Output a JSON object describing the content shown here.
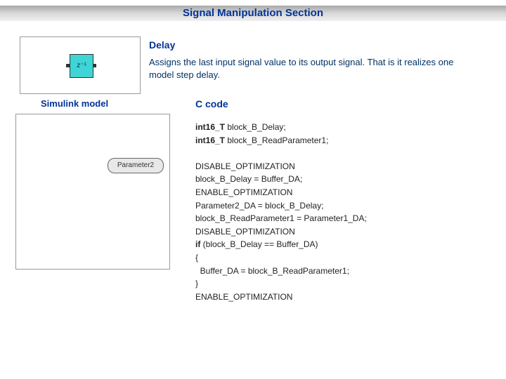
{
  "title": "Signal Manipulation Section",
  "section": {
    "heading": "Delay",
    "description_line1": "Assigns the last input signal value to its output signal. That is it realizes one",
    "description_line2": "model step delay."
  },
  "labels": {
    "simulink": "Simulink model",
    "ccode": "C code"
  },
  "delay_block": {
    "symbol": "z⁻¹"
  },
  "model": {
    "param_block": "Parameter2"
  },
  "code": {
    "l1_kw": "int16_T",
    "l1_rest": " block_B_Delay;",
    "l2_kw": "int16_T",
    "l2_rest": " block_B_ReadParameter1;",
    "l3": "DISABLE_OPTIMIZATION",
    "l4": "block_B_Delay = Buffer_DA;",
    "l5": "ENABLE_OPTIMIZATION",
    "l6": "Parameter2_DA = block_B_Delay;",
    "l7": "block_B_ReadParameter1 = Parameter1_DA;",
    "l8": "DISABLE_OPTIMIZATION",
    "l9_kw": "if",
    "l9_rest": " (block_B_Delay == Buffer_DA)",
    "l10": "{",
    "l11": "  Buffer_DA = block_B_ReadParameter1;",
    "l12": "}",
    "l13": "ENABLE_OPTIMIZATION"
  }
}
